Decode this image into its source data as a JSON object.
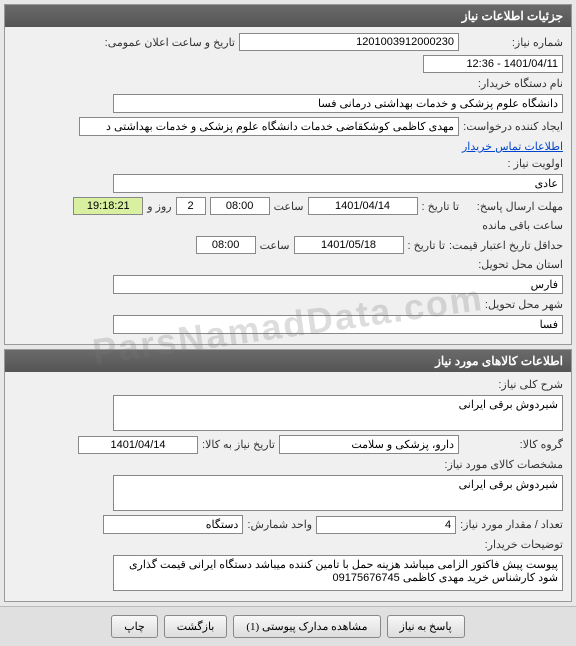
{
  "panel1": {
    "title": "جزئیات اطلاعات نیاز",
    "need_no_label": "شماره نیاز:",
    "need_no": "1201003912000230",
    "announce_label": "تاریخ و ساعت اعلان عمومی:",
    "announce_value": "1401/04/11 - 12:36",
    "buyer_org_label": "نام دستگاه خریدار:",
    "buyer_org": "دانشگاه علوم پزشکی و خدمات بهداشتی درمانی فسا",
    "creator_label": "ایجاد کننده درخواست:",
    "creator": "مهدی کاظمی کوشکقاضی خدمات دانشگاه علوم پزشکی و خدمات بهداشتی د",
    "contact_link": "اطلاعات تماس خریدار",
    "priority_label": "اولویت نیاز :",
    "priority": "عادی",
    "deadline_label": "مهلت ارسال پاسخ:",
    "to_date_label": "تا تاریخ :",
    "deadline_date": "1401/04/14",
    "time_label": "ساعت",
    "deadline_time": "08:00",
    "days_remaining": "2",
    "days_label": "روز و",
    "time_remaining": "19:18:21",
    "remaining_label": "ساعت باقی مانده",
    "validity_label": "حداقل تاریخ اعتبار قیمت:",
    "validity_date": "1401/05/18",
    "validity_time": "08:00",
    "province_label": "استان محل تحویل:",
    "province": "فارس",
    "city_label": "شهر محل تحویل:",
    "city": "فسا"
  },
  "panel2": {
    "title": "اطلاعات کالاهای مورد نیاز",
    "desc_label": "شرح کلی نیاز:",
    "desc": "شیردوش برقی ایرانی",
    "group_label": "گروه کالا:",
    "group": "دارو، پزشکی و سلامت",
    "need_date_label": "تاریخ نیاز به کالا:",
    "need_date": "1401/04/14",
    "spec_label": "مشخصات کالای مورد نیاز:",
    "spec": "شیردوش برقی ایرانی",
    "qty_label": "تعداد / مقدار مورد نیاز:",
    "qty": "4",
    "unit_label": "واحد شمارش:",
    "unit": "دستگاه",
    "buyer_notes_label": "توضیحات خریدار:",
    "buyer_notes": "پیوست پیش فاکتور الزامی میباشد  هزینه حمل با تامین کننده میباشد  دستگاه ایرانی قیمت گذاری شود کارشناس خرید مهدی کاظمی 09175676745"
  },
  "buttons": {
    "respond": "پاسخ به نیاز",
    "attachments": "مشاهده مدارک پیوستی (1)",
    "back": "بازگشت",
    "print": "چاپ"
  },
  "watermark": "ParsNamadData.com"
}
